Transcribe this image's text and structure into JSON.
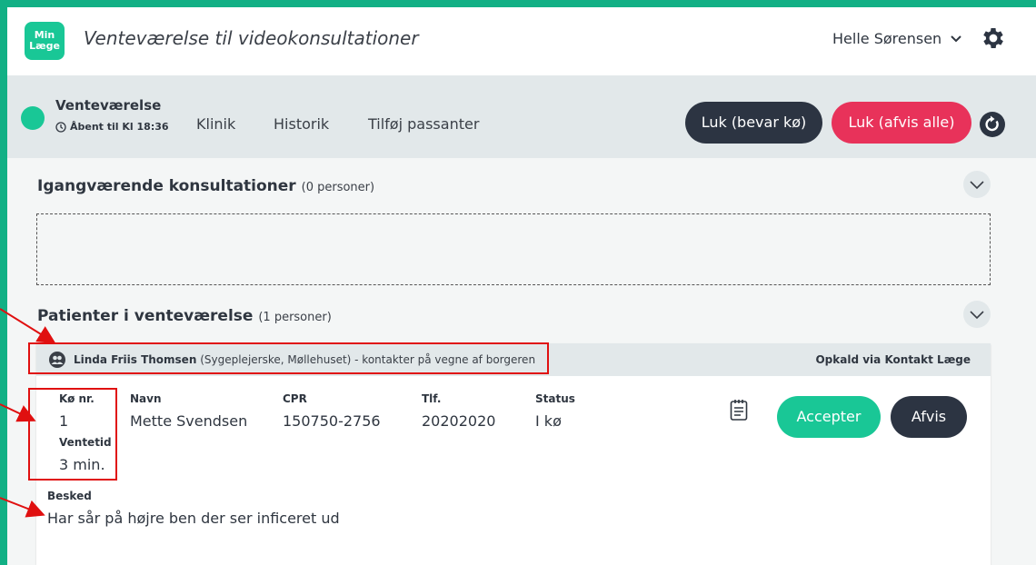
{
  "header": {
    "logo_line1": "Min",
    "logo_line2": "Læge",
    "title": "Venteværelse til videokonsultationer",
    "user_name": "Helle Sørensen"
  },
  "waiting_room": {
    "name": "Venteværelse",
    "open_until": "Åbent til Kl 18:36",
    "nav": [
      "Klinik",
      "Historik",
      "Tilføj passanter"
    ],
    "close_keep_queue": "Luk (bevar kø)",
    "close_reject_all": "Luk (afvis alle)"
  },
  "ongoing": {
    "title": "Igangværende konsultationer",
    "count": "(0 personer)"
  },
  "patients": {
    "title": "Patienter i venteværelse",
    "count": "(1 personer)",
    "agent_name": "Linda Friis Thomsen",
    "agent_detail": "(Sygeplejerske, Møllehuset) - kontakter på vegne af borgeren",
    "call_via": "Opkald via Kontakt Læge",
    "queue_label": "Kø nr.",
    "queue_value": "1",
    "wait_label": "Ventetid",
    "wait_value": "3 min.",
    "name_label": "Navn",
    "name_value": "Mette Svendsen",
    "cpr_label": "CPR",
    "cpr_value": "150750-2756",
    "phone_label": "Tlf.",
    "phone_value": "20202020",
    "status_label": "Status",
    "status_value": "I kø",
    "accept": "Accepter",
    "reject": "Afvis",
    "message_label": "Besked",
    "message_value": "Har sår på højre ben der ser inficeret ud"
  },
  "colors": {
    "brand_green": "#19c796",
    "frame_green": "#12b085",
    "dark_button": "#2c3442",
    "red_button": "#e8325a",
    "annotation_red": "#e01010"
  },
  "icons": [
    "chevron-down-icon",
    "gear-icon",
    "clock-icon",
    "refresh-icon",
    "people-icon",
    "notes-icon"
  ]
}
